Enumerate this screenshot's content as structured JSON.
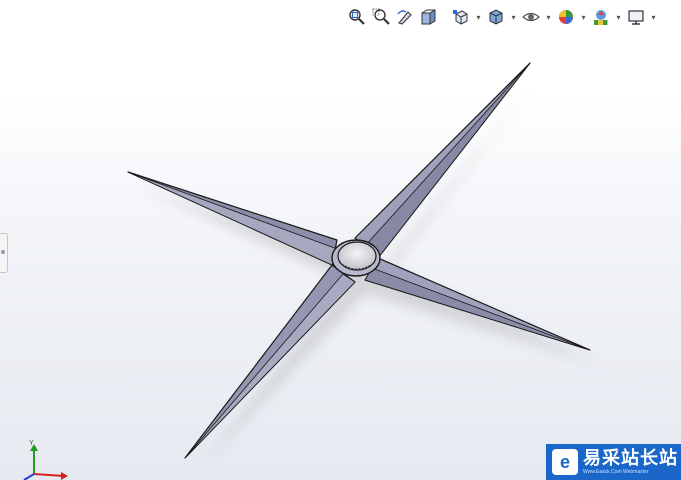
{
  "viewport": {
    "model": "four-blade-star-part"
  },
  "toolbar": {
    "items": [
      {
        "name": "zoom-to-fit-icon"
      },
      {
        "name": "zoom-to-area-icon"
      },
      {
        "name": "previous-view-icon"
      },
      {
        "name": "section-view-icon"
      },
      {
        "name": "view-orientation-icon",
        "has_dropdown": true
      },
      {
        "name": "display-style-icon",
        "has_dropdown": true
      },
      {
        "name": "hide-show-items-icon",
        "has_dropdown": true
      },
      {
        "name": "edit-appearance-icon",
        "has_dropdown": true
      },
      {
        "name": "apply-scene-icon",
        "has_dropdown": true
      },
      {
        "name": "view-settings-icon",
        "has_dropdown": true
      }
    ]
  },
  "triad": {
    "y_label": "Y",
    "colors": {
      "x": "#d42020",
      "y": "#20a020",
      "z": "#2040d0"
    }
  },
  "watermark": {
    "logo_char": "e",
    "title": "易采站长站",
    "url": "Www.Easck.Com Webmaster"
  },
  "colors": {
    "blade": "#9a9bb5",
    "edge": "#1a1a1a",
    "hub": "#d8d8dc",
    "watermark_bg": "#1a66c9"
  }
}
